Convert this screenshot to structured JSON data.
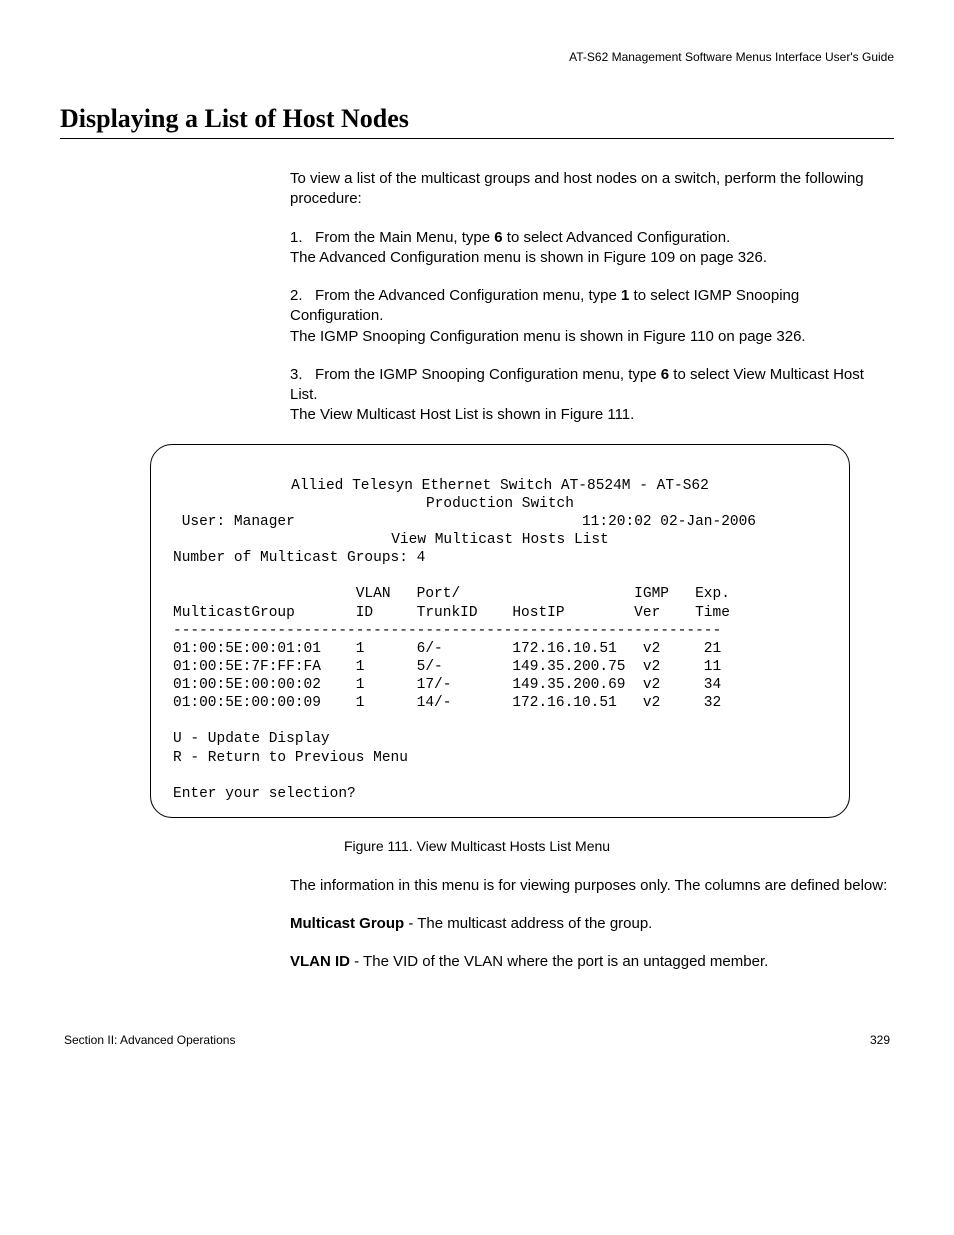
{
  "header": {
    "running_head": "AT-S62 Management Software Menus Interface User's Guide"
  },
  "title": "Displaying a List of Host Nodes",
  "intro": "To view a list of the multicast groups and host nodes on a switch, perform the following procedure:",
  "steps": {
    "s1_pre": "From the Main Menu, type ",
    "s1_bold": "6",
    "s1_post": " to select Advanced Configuration.",
    "s1_cont": "The Advanced Configuration menu is shown in Figure 109 on page 326.",
    "s2_pre": "From the Advanced Configuration menu, type ",
    "s2_bold": "1",
    "s2_post": " to select IGMP Snooping Configuration.",
    "s2_cont": "The IGMP Snooping Configuration menu is shown in Figure 110 on page 326.",
    "s3_pre": "From the IGMP Snooping Configuration menu, type ",
    "s3_bold": "6",
    "s3_post": " to select View Multicast Host List.",
    "s3_cont": "The View Multicast Host List is shown in Figure 111."
  },
  "terminal": {
    "line1": "Allied Telesyn Ethernet Switch AT-8524M - AT-S62",
    "line2": "Production Switch",
    "user_label": " User: Manager",
    "timestamp": "11:20:02 02-Jan-2006",
    "screen_title": "View Multicast Hosts List",
    "groups_line": "Number of Multicast Groups: 4",
    "hdr1": "                     VLAN   Port/                    IGMP   Exp.",
    "hdr2": "MulticastGroup       ID     TrunkID    HostIP        Ver    Time",
    "rule": "---------------------------------------------------------------",
    "r1": "01:00:5E:00:01:01    1      6/-        172.16.10.51   v2     21",
    "r2": "01:00:5E:7F:FF:FA    1      5/-        149.35.200.75  v2     11",
    "r3": "01:00:5E:00:00:02    1      17/-       149.35.200.69  v2     34",
    "r4": "01:00:5E:00:00:09    1      14/-       172.16.10.51   v2     32",
    "opt_u": "U - Update Display",
    "opt_r": "R - Return to Previous Menu",
    "prompt": "Enter your selection?"
  },
  "figure_caption": "Figure 111. View Multicast Hosts List Menu",
  "after": {
    "p1": "The information in this menu is for viewing purposes only. The columns are defined below:",
    "mg_bold": "Multicast Group",
    "mg_rest": " - The multicast address of the group.",
    "vlan_bold": "VLAN ID",
    "vlan_rest": " - The VID of the VLAN where the port is an untagged member."
  },
  "footer": {
    "left": "Section II: Advanced Operations",
    "right": "329"
  },
  "chart_data": {
    "type": "table",
    "title": "View Multicast Hosts List",
    "columns": [
      "MulticastGroup",
      "VLAN ID",
      "Port/TrunkID",
      "HostIP",
      "IGMP Ver",
      "Exp. Time"
    ],
    "rows": [
      [
        "01:00:5E:00:01:01",
        1,
        "6/-",
        "172.16.10.51",
        "v2",
        21
      ],
      [
        "01:00:5E:7F:FF:FA",
        1,
        "5/-",
        "149.35.200.75",
        "v2",
        11
      ],
      [
        "01:00:5E:00:00:02",
        1,
        "17/-",
        "149.35.200.69",
        "v2",
        34
      ],
      [
        "01:00:5E:00:00:09",
        1,
        "14/-",
        "172.16.10.51",
        "v2",
        32
      ]
    ],
    "number_of_multicast_groups": 4
  }
}
